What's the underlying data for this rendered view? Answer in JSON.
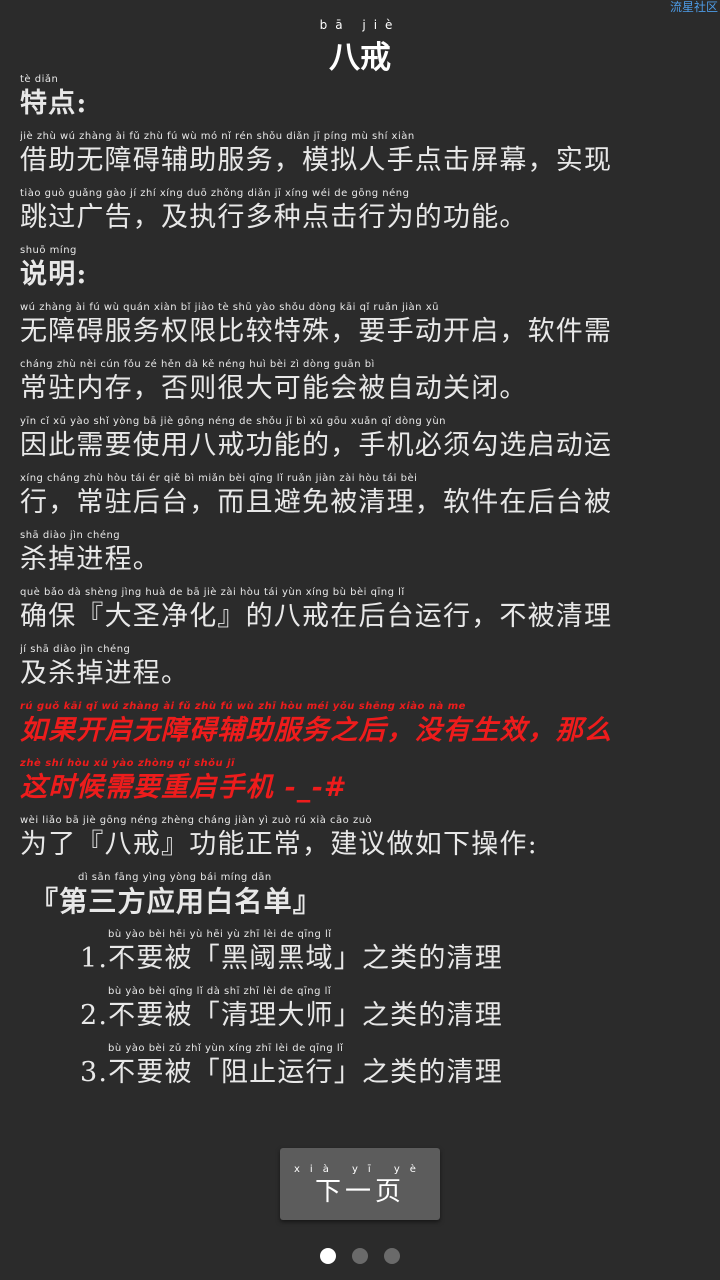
{
  "watermark": "流星社区",
  "title": {
    "pinyin": "bā jiè",
    "text": "八戒"
  },
  "lines": [
    {
      "pinyin": "tè diǎn",
      "text": "特点:",
      "kind": "heading"
    },
    {
      "pinyin": "jiè zhù wú zhàng ài fǔ zhù fú wù mó nǐ rén shǒu diǎn jī píng mù shí xiàn",
      "text": "借助无障碍辅助服务，模拟人手点击屏幕，实现"
    },
    {
      "pinyin": "tiào guò guǎng gào jí zhí xíng duō zhǒng diǎn jī xíng wéi de gōng néng",
      "text": "跳过广告，及执行多种点击行为的功能。"
    },
    {
      "pinyin": "shuō míng",
      "text": "说明:",
      "kind": "heading"
    },
    {
      "pinyin": "wú zhàng ài fú wù quán xiàn bǐ jiào tè shū yào shǒu dòng kāi qǐ ruǎn jiàn xū",
      "text": "无障碍服务权限比较特殊，要手动开启，软件需"
    },
    {
      "pinyin": "cháng zhù nèi cún fǒu zé hěn dà kě néng huì bèi zì dòng guān bì",
      "text": "常驻内存，否则很大可能会被自动关闭。"
    },
    {
      "pinyin": "yīn cǐ xū yào shǐ yòng bā jiè gōng néng de shǒu jī bì xū gōu xuǎn qǐ dòng yùn",
      "text": "因此需要使用八戒功能的，手机必须勾选启动运"
    },
    {
      "pinyin": "xíng cháng zhù hòu tái ér qiě bì miǎn bèi qīng lǐ ruǎn jiàn zài hòu tái bèi",
      "text": "行，常驻后台，而且避免被清理，软件在后台被"
    },
    {
      "pinyin": "shā diào jìn chéng",
      "text": "杀掉进程。"
    },
    {
      "pinyin": "què bǎo dà shèng jìng huà de bā jiè zài hòu tái yùn xíng bù bèi qīng lǐ",
      "text": "确保『大圣净化』的八戒在后台运行，不被清理"
    },
    {
      "pinyin": "jí shā diào jìn chéng",
      "text": "及杀掉进程。"
    },
    {
      "pinyin": "rú guǒ kāi qǐ wú zhàng ài fǔ zhù fú wù zhī hòu méi yǒu shēng xiào nà me",
      "text": "如果开启无障碍辅助服务之后，没有生效，那么",
      "kind": "red"
    },
    {
      "pinyin": "zhè shí hòu xū yào zhòng qǐ shǒu jī",
      "text": "这时候需要重启手机 -_-#",
      "kind": "red"
    },
    {
      "pinyin": "wèi liǎo bā jiè gōng néng zhèng cháng jiàn yì zuò rú xià cāo zuò",
      "text": "为了『八戒』功能正常，建议做如下操作:"
    },
    {
      "pinyin": "dì sān fāng yìng yòng bái míng dān",
      "text": "『第三方应用白名单』",
      "kind": "section"
    },
    {
      "pinyin": "bù yào bèi hēi yù hēi yù zhī lèi de qīng lǐ",
      "text": "1.不要被「黑阈黑域」之类的清理",
      "kind": "item"
    },
    {
      "pinyin": "bù yào bèi qīng lǐ dà shī zhī lèi de qīng lǐ",
      "text": "2.不要被「清理大师」之类的清理",
      "kind": "item"
    },
    {
      "pinyin": "bù yào bèi zǔ zhǐ yùn xíng zhī lèi de qīng lǐ",
      "text": "3.不要被「阻止运行」之类的清理",
      "kind": "item"
    }
  ],
  "next_button": {
    "pinyin": "xià yī yè",
    "label": "下一页"
  },
  "pagination": {
    "total": 3,
    "active": 1
  }
}
